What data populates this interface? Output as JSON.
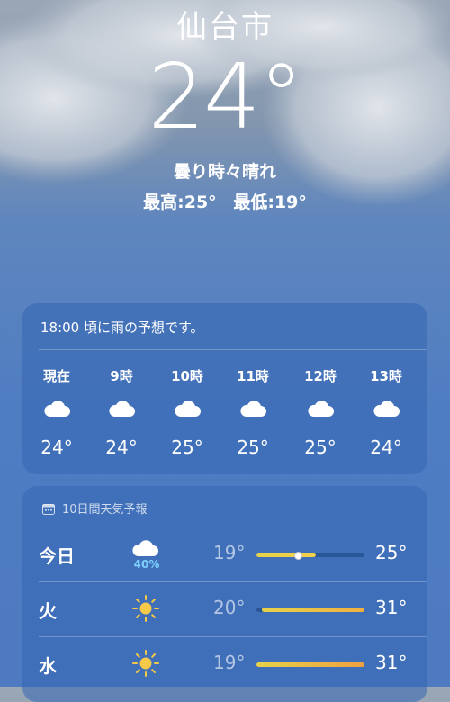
{
  "location": {
    "city": "仙台市",
    "temperature": "24°",
    "condition": "曇り時々晴れ",
    "high": "最高:25°",
    "low": "最低:19°"
  },
  "hourly": {
    "alert": "18:00 頃に雨の予想です。",
    "items": [
      {
        "time": "現在",
        "icon": "cloud-icon",
        "temp": "24°"
      },
      {
        "time": "9時",
        "icon": "cloud-icon",
        "temp": "24°"
      },
      {
        "time": "10時",
        "icon": "cloud-icon",
        "temp": "25°"
      },
      {
        "time": "11時",
        "icon": "cloud-icon",
        "temp": "25°"
      },
      {
        "time": "12時",
        "icon": "cloud-icon",
        "temp": "25°"
      },
      {
        "time": "13時",
        "icon": "cloud-icon",
        "temp": "24°"
      }
    ]
  },
  "daily": {
    "title": "10日間天気予報",
    "rows": [
      {
        "day": "今日",
        "icon": "rain-cloud-icon",
        "precip": "40%",
        "low": "19°",
        "high": "25°",
        "range_start": 0.0,
        "range_end": 0.55,
        "current": 0.38,
        "fill_color": "#f2d04a"
      },
      {
        "day": "火",
        "icon": "sun-icon",
        "precip": "",
        "low": "20°",
        "high": "31°",
        "range_start": 0.05,
        "range_end": 1.0,
        "fill_color": "#f0b040"
      },
      {
        "day": "水",
        "icon": "sun-icon",
        "precip": "",
        "low": "19°",
        "high": "31°",
        "range_start": 0.0,
        "range_end": 1.0,
        "fill_color": "#f0a040"
      }
    ]
  },
  "colors": {
    "card": "#3466b2",
    "precip": "#7fd0ff",
    "sun": "#f7c948"
  }
}
